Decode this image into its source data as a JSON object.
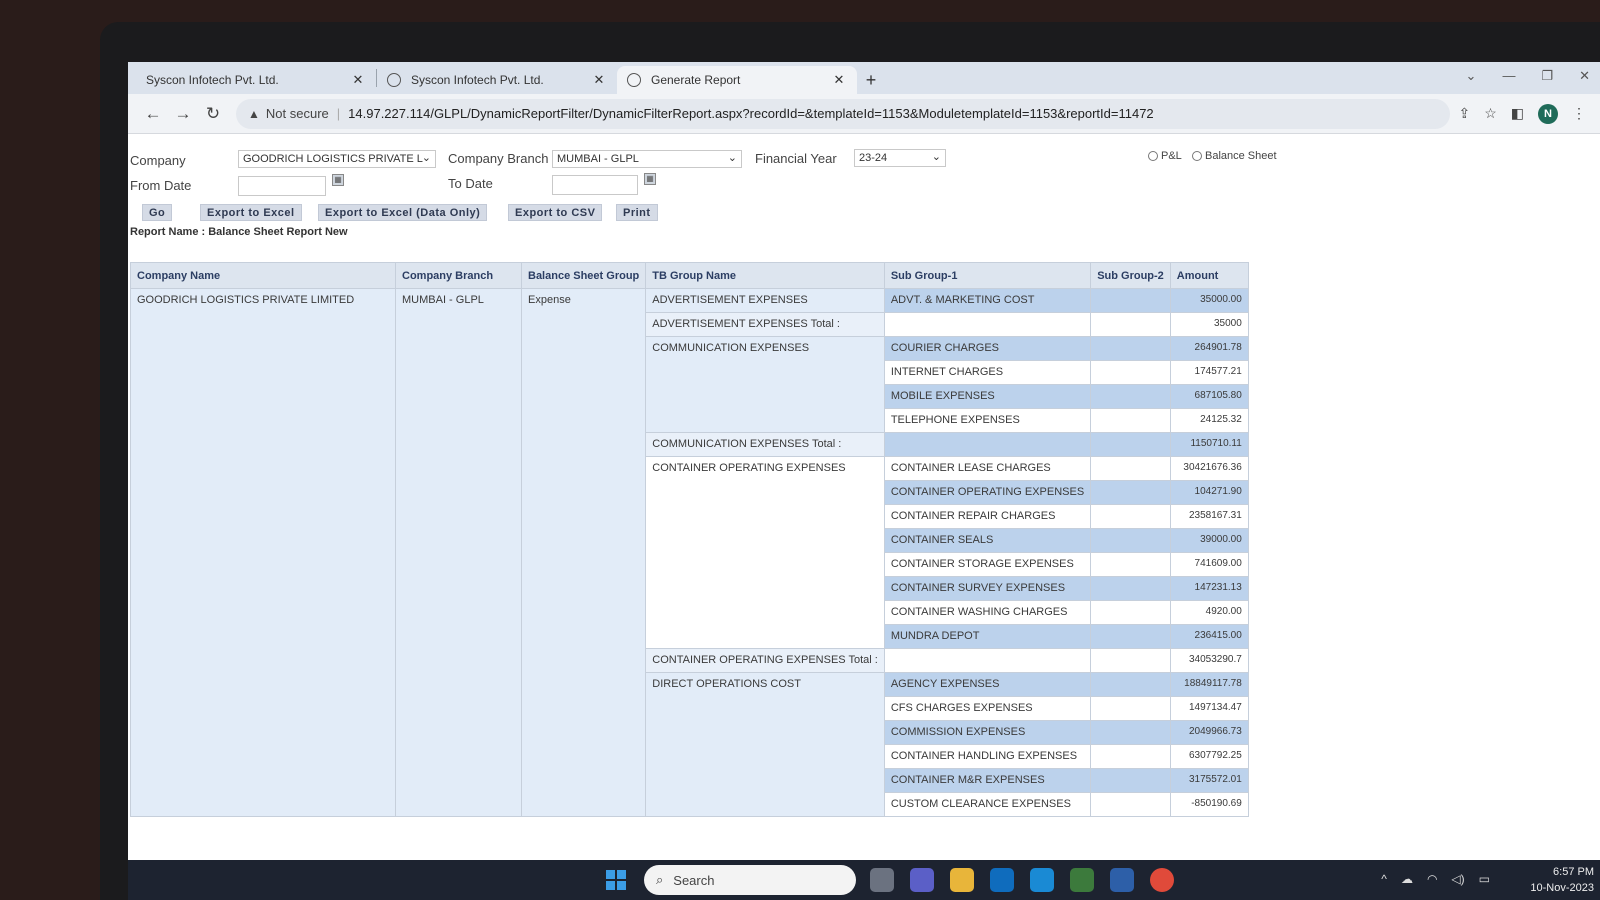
{
  "browser": {
    "tabs": [
      {
        "title": "Syscon Infotech Pvt. Ltd.",
        "active": false
      },
      {
        "title": "Syscon Infotech Pvt. Ltd.",
        "active": false
      },
      {
        "title": "Generate Report",
        "active": true
      }
    ],
    "security_label": "Not secure",
    "url": "14.97.227.114/GLPL/DynamicReportFilter/DynamicFilterReport.aspx?recordId=&templateId=1153&ModuletemplateId=1153&reportId=11472",
    "profile_initial": "N"
  },
  "filters": {
    "company_label": "Company",
    "company_value": "GOODRICH LOGISTICS PRIVATE L",
    "branch_label": "Company Branch",
    "branch_value": "MUMBAI - GLPL",
    "fy_label": "Financial Year",
    "fy_value": "23-24",
    "from_date_label": "From Date",
    "to_date_label": "To Date",
    "radio_pl": "P&L",
    "radio_bs": "Balance Sheet"
  },
  "toolbar": {
    "go": "Go",
    "export_excel": "Export to Excel",
    "export_excel_data": "Export to Excel (Data Only)",
    "export_csv": "Export to CSV",
    "print": "Print"
  },
  "report_name": "Report Name : Balance Sheet Report New",
  "grid": {
    "headers": [
      "Company Name",
      "Company Branch",
      "Balance Sheet Group",
      "TB Group Name",
      "Sub Group-1",
      "Sub Group-2",
      "Amount"
    ],
    "company": "GOODRICH LOGISTICS PRIVATE LIMITED",
    "branch": "MUMBAI - GLPL",
    "bs_group": "Expense",
    "groups": {
      "adv": "ADVERTISEMENT EXPENSES",
      "adv_total": "ADVERTISEMENT EXPENSES Total :",
      "comm": "COMMUNICATION EXPENSES",
      "comm_total": "COMMUNICATION EXPENSES Total :",
      "cont": "CONTAINER OPERATING EXPENSES",
      "cont_total": "CONTAINER OPERATING EXPENSES Total :",
      "direct": "DIRECT OPERATIONS COST"
    },
    "rows": [
      {
        "sub": "ADVT. & MARKETING COST",
        "amt": "35000.00"
      },
      {
        "sub": "",
        "amt": "35000"
      },
      {
        "sub": "COURIER CHARGES",
        "amt": "264901.78"
      },
      {
        "sub": "INTERNET CHARGES",
        "amt": "174577.21"
      },
      {
        "sub": "MOBILE EXPENSES",
        "amt": "687105.80"
      },
      {
        "sub": "TELEPHONE EXPENSES",
        "amt": "24125.32"
      },
      {
        "sub": "",
        "amt": "1150710.11"
      },
      {
        "sub": "CONTAINER LEASE CHARGES",
        "amt": "30421676.36"
      },
      {
        "sub": "CONTAINER OPERATING EXPENSES",
        "amt": "104271.90"
      },
      {
        "sub": "CONTAINER REPAIR CHARGES",
        "amt": "2358167.31"
      },
      {
        "sub": "CONTAINER SEALS",
        "amt": "39000.00"
      },
      {
        "sub": "CONTAINER STORAGE EXPENSES",
        "amt": "741609.00"
      },
      {
        "sub": "CONTAINER SURVEY EXPENSES",
        "amt": "147231.13"
      },
      {
        "sub": "CONTAINER WASHING CHARGES",
        "amt": "4920.00"
      },
      {
        "sub": "MUNDRA DEPOT",
        "amt": "236415.00"
      },
      {
        "sub": "",
        "amt": "34053290.7"
      },
      {
        "sub": "AGENCY EXPENSES",
        "amt": "18849117.78"
      },
      {
        "sub": "CFS CHARGES EXPENSES",
        "amt": "1497134.47"
      },
      {
        "sub": "COMMISSION EXPENSES",
        "amt": "2049966.73"
      },
      {
        "sub": "CONTAINER HANDLING EXPENSES",
        "amt": "6307792.25"
      },
      {
        "sub": "CONTAINER M&R EXPENSES",
        "amt": "3175572.01"
      },
      {
        "sub": "CUSTOM CLEARANCE EXPENSES",
        "amt": "-850190.69"
      }
    ]
  },
  "taskbar": {
    "search_placeholder": "Search",
    "time": "6:57 PM",
    "date": "10-Nov-2023"
  },
  "colors": {
    "header_bg": "#dde5ef",
    "row_light": "#e2ecf8",
    "row_medium": "#bcd2ec",
    "accent_blue": "#3b9de6"
  }
}
